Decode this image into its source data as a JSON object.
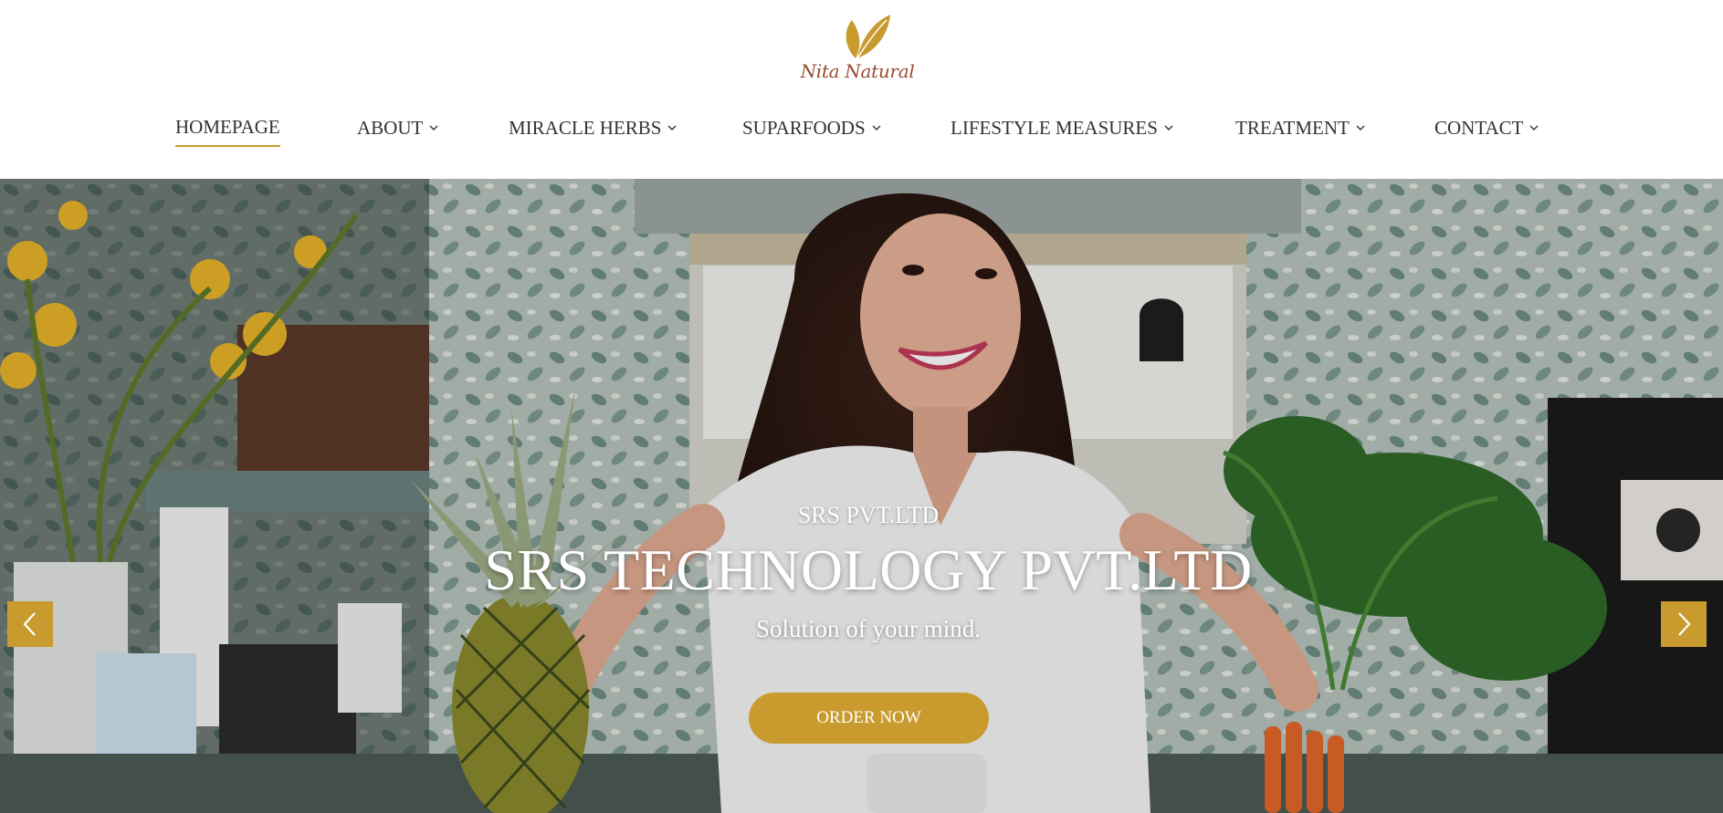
{
  "brand": {
    "name": "Nita Natural",
    "accent_color": "#c99a2e",
    "logo_text_color": "#9a4a30"
  },
  "nav": {
    "items": [
      {
        "label": "HOMEPAGE",
        "active": true,
        "dropdown": false
      },
      {
        "label": "ABOUT",
        "active": false,
        "dropdown": true
      },
      {
        "label": "MIRACLE HERBS",
        "active": false,
        "dropdown": true
      },
      {
        "label": "SUPARFOODS",
        "active": false,
        "dropdown": true
      },
      {
        "label": "LIFESTYLE MEASURES",
        "active": false,
        "dropdown": true
      },
      {
        "label": "TREATMENT",
        "active": false,
        "dropdown": true
      },
      {
        "label": "CONTACT",
        "active": false,
        "dropdown": true
      }
    ]
  },
  "hero": {
    "subtitle": "SRS PVT.LTD",
    "title": "SRS TECHNOLOGY PVT.LTD",
    "tagline": "Solution of your mind.",
    "cta_label": "ORDER NOW",
    "prev_icon": "chevron-left-icon",
    "next_icon": "chevron-right-icon"
  }
}
